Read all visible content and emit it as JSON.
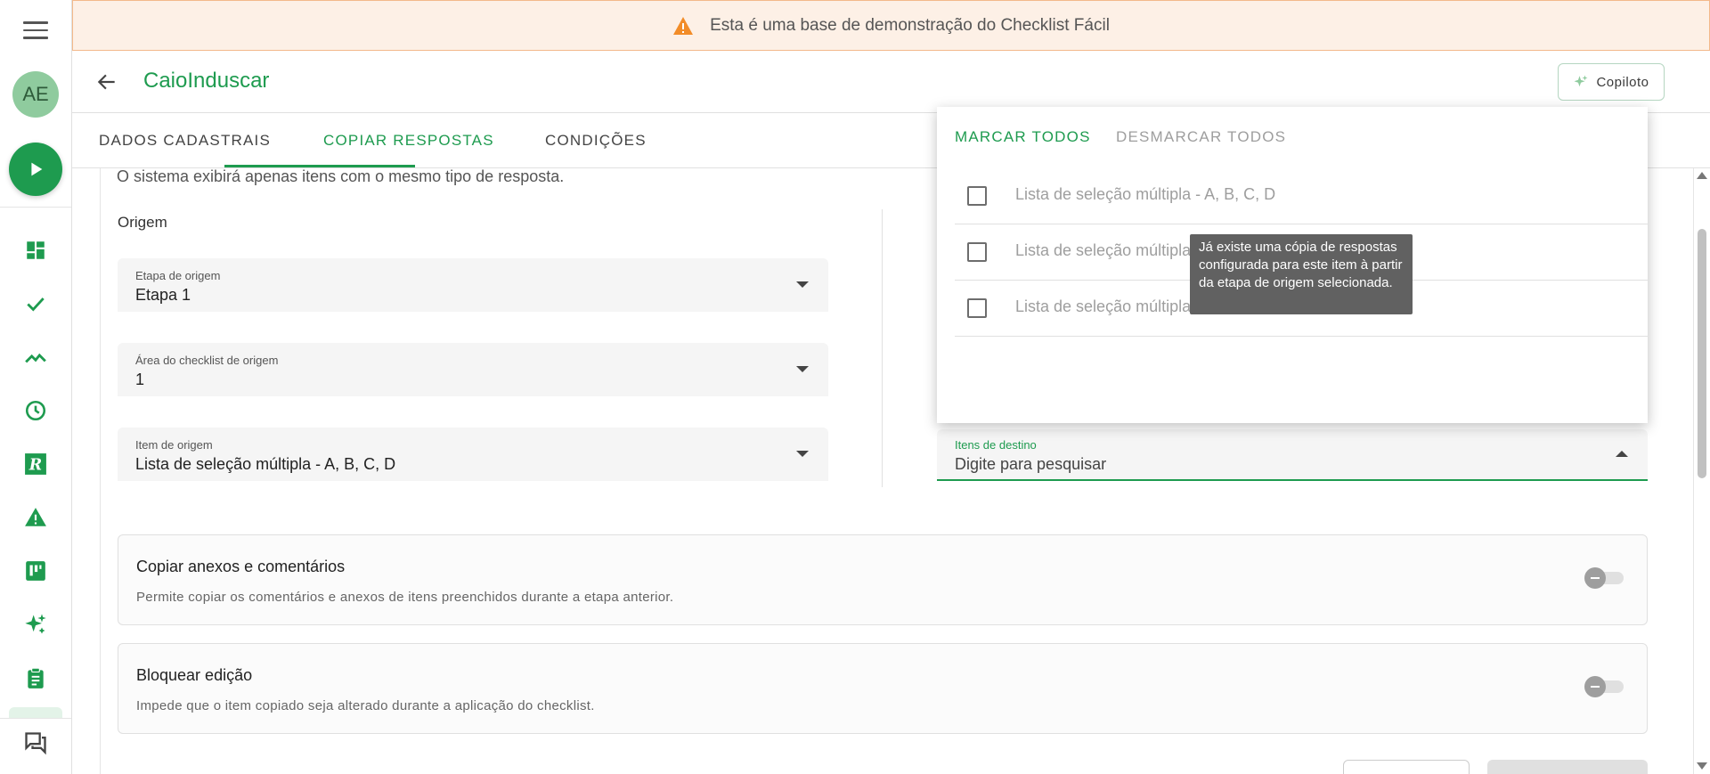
{
  "banner": {
    "icon": "warning-icon",
    "text": "Esta é uma base de demonstração do Checklist Fácil"
  },
  "sidebar": {
    "avatar": "AE",
    "items": [
      {
        "icon": "dashboard-icon"
      },
      {
        "icon": "check-icon"
      },
      {
        "icon": "trending-icon"
      },
      {
        "icon": "clock-icon"
      },
      {
        "icon": "r-icon"
      },
      {
        "icon": "alert-icon"
      },
      {
        "icon": "board-icon"
      },
      {
        "icon": "sparkle-icon"
      },
      {
        "icon": "clipboard-icon"
      },
      {
        "icon": "chat-icon"
      }
    ]
  },
  "header": {
    "title": "CaioInduscar",
    "copilot_label": "Copiloto"
  },
  "tabs": [
    {
      "label": "DADOS CADASTRAIS",
      "active": false
    },
    {
      "label": "COPIAR RESPOSTAS",
      "active": true
    },
    {
      "label": "CONDIÇÕES",
      "active": false
    }
  ],
  "main": {
    "info_text": "O sistema exibirá apenas itens com o mesmo tipo de resposta.",
    "origin_label": "Origem",
    "fields": {
      "stage": {
        "label": "Etapa de origem",
        "value": "Etapa 1"
      },
      "area": {
        "label": "Área do checklist de origem",
        "value": "1"
      },
      "item": {
        "label": "Item de origem",
        "value": "Lista de seleção múltipla - A, B, C, D"
      }
    },
    "destination": {
      "label": "Itens de destino",
      "placeholder": "Digite para pesquisar"
    }
  },
  "dropdown": {
    "select_all": "MARCAR TODOS",
    "deselect_all": "DESMARCAR TODOS",
    "options": [
      "Lista de seleção múltipla - A, B, C, D",
      "Lista de seleção múltipla",
      "Lista de seleção múltipla"
    ]
  },
  "tooltip": "Já existe uma cópia de respostas configurada para este item à partir da etapa de origem selecionada.",
  "cards": {
    "copy_attachments": {
      "title": "Copiar anexos e comentários",
      "description": "Permite copiar os comentários e anexos de itens preenchidos durante a etapa anterior.",
      "enabled": false
    },
    "lock_edit": {
      "title": "Bloquear edição",
      "description": "Impede que o item copiado seja alterado durante a aplicação do checklist.",
      "enabled": false
    }
  },
  "colors": {
    "primary": "#1e9b4f",
    "banner_bg": "#fdf0e6",
    "warning": "#f28c28",
    "tooltip_bg": "#616161"
  }
}
